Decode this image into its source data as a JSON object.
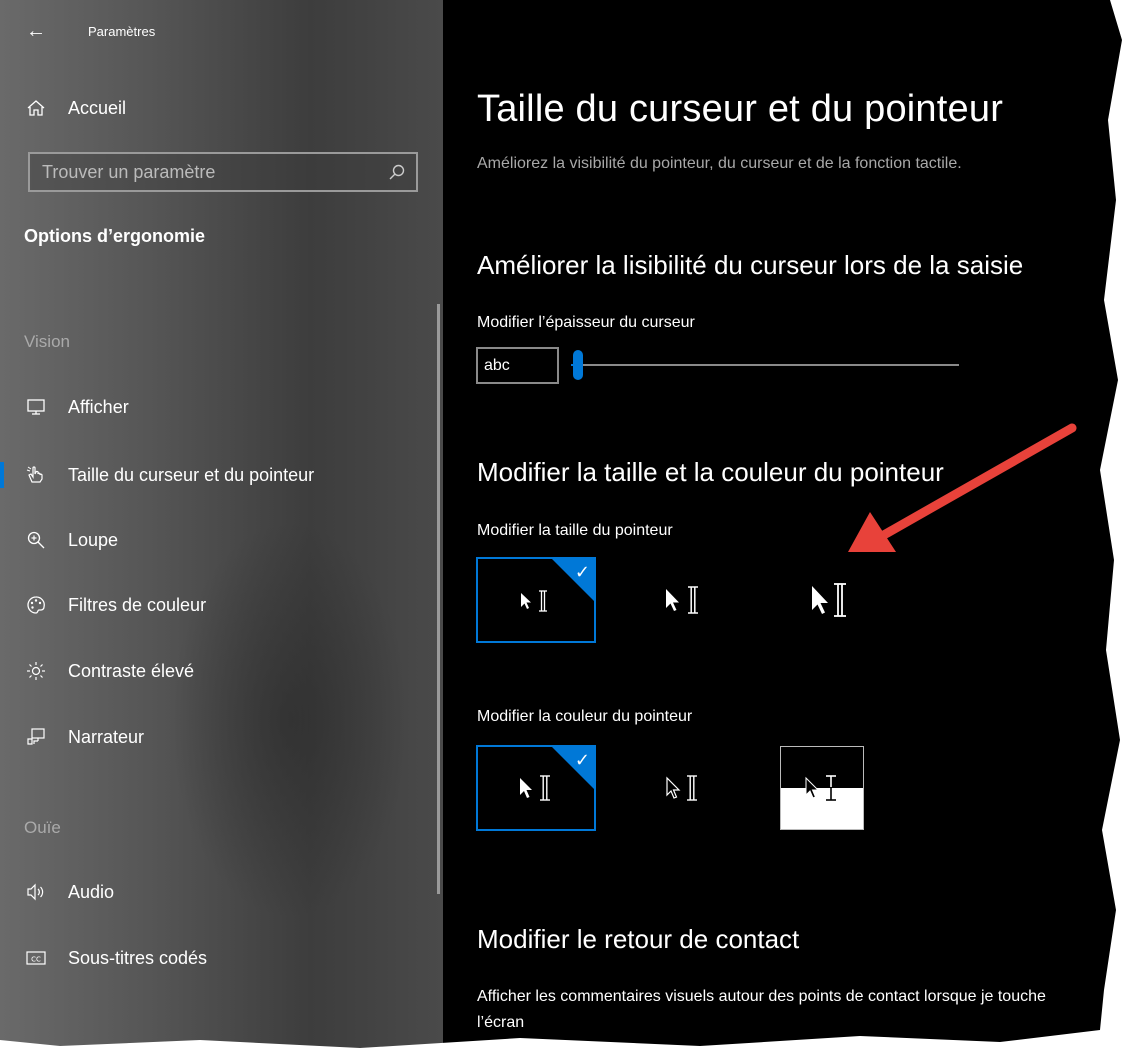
{
  "window": {
    "title": "Paramètres"
  },
  "sidebar": {
    "home_label": "Accueil",
    "search_placeholder": "Trouver un paramètre",
    "section_title": "Options d’ergonomie",
    "group_vision": "Vision",
    "group_ouie": "Ouïe",
    "items": [
      {
        "label": "Afficher",
        "icon": "monitor-icon"
      },
      {
        "label": "Taille du curseur et du pointeur",
        "icon": "pointer-hand-icon",
        "selected": true
      },
      {
        "label": "Loupe",
        "icon": "magnifier-icon"
      },
      {
        "label": "Filtres de couleur",
        "icon": "palette-icon"
      },
      {
        "label": "Contraste élevé",
        "icon": "sun-icon"
      },
      {
        "label": "Narrateur",
        "icon": "narrator-icon"
      },
      {
        "label": "Audio",
        "icon": "speaker-icon"
      },
      {
        "label": "Sous-titres codés",
        "icon": "cc-icon"
      }
    ]
  },
  "main": {
    "title": "Taille du curseur et du pointeur",
    "description": "Améliorez la visibilité du pointeur, du curseur et de la fonction tactile.",
    "cursor_section": {
      "heading": "Améliorer la lisibilité du curseur lors de la saisie",
      "thickness_label": "Modifier l’épaisseur du curseur",
      "preview_text": "abc",
      "thickness_value": 1
    },
    "pointer_section": {
      "heading": "Modifier la taille et la couleur du pointeur",
      "size_label": "Modifier la taille du pointeur",
      "size_options": [
        "small",
        "medium",
        "large"
      ],
      "size_selected": 0,
      "color_label": "Modifier la couleur du pointeur",
      "color_options": [
        "white",
        "black",
        "inverted"
      ],
      "color_selected": 0
    },
    "touch_section": {
      "heading": "Modifier le retour de contact",
      "text": "Afficher les commentaires visuels autour des points de contact lorsque je touche l’écran"
    }
  },
  "colors": {
    "accent": "#0078d7",
    "annotation_arrow": "#e8423a",
    "background": "#000000"
  }
}
